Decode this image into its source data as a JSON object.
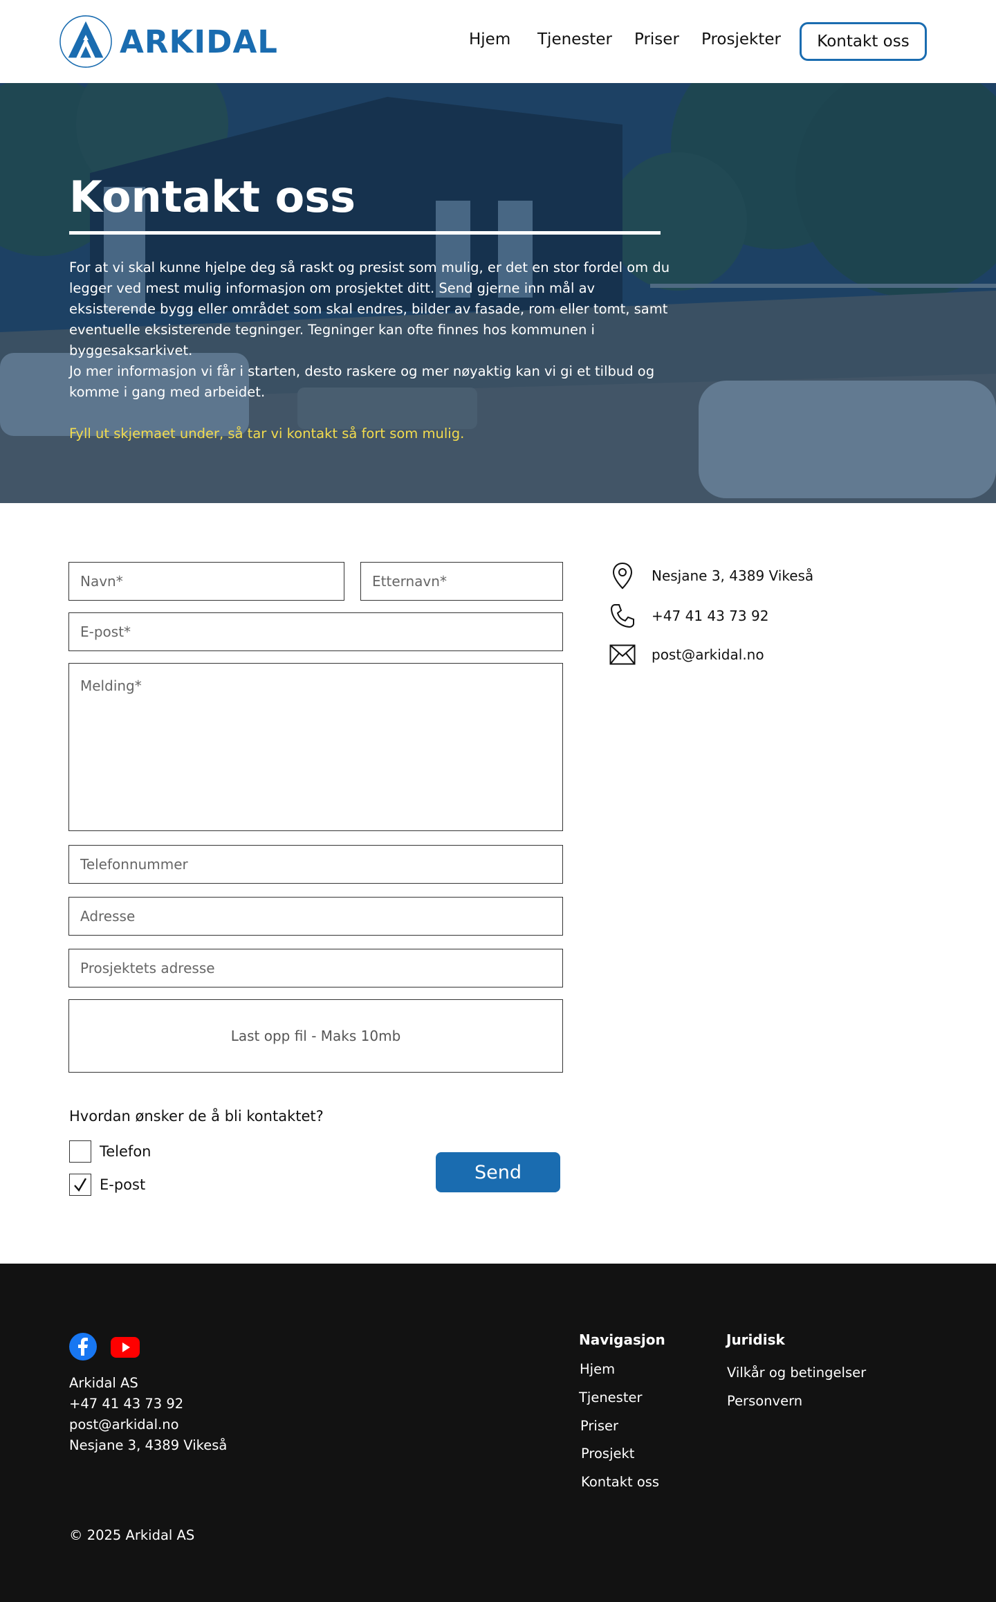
{
  "header": {
    "brand": "ARKIDAL",
    "nav": [
      "Hjem",
      "Tjenester",
      "Priser",
      "Prosjekter"
    ],
    "cta_label": "Kontakt oss"
  },
  "hero": {
    "title": "Kontakt oss",
    "paragraph1": "For at vi skal kunne hjelpe deg så raskt og presist som mulig, er det en stor fordel om du legger ved mest mulig informasjon om prosjektet ditt. Send gjerne inn mål av eksisterende bygg eller området som skal endres, bilder av fasade, rom eller tomt, samt eventuelle eksisterende tegninger. Tegninger kan ofte finnes hos kommunen i byggesaksarkivet.",
    "paragraph2": "Jo mer informasjon vi får i starten, desto raskere og mer nøyaktig kan vi gi et tilbud og komme i gang med arbeidet.",
    "paragraph3": "Fyll ut skjemaet under, så tar vi kontakt så fort som mulig."
  },
  "form": {
    "first_name_placeholder": "Navn*",
    "last_name_placeholder": "Etternavn*",
    "email_placeholder": "E-post*",
    "message_placeholder": "Melding*",
    "phone_placeholder": "Telefonnummer",
    "address_placeholder": "Adresse",
    "project_address_placeholder": "Prosjektets adresse",
    "upload_label": "Last opp fil - Maks 10mb",
    "contact_question": "Hvordan ønsker de å bli kontaktet?",
    "options": [
      {
        "label": "Telefon",
        "checked": false
      },
      {
        "label": "E-post",
        "checked": true
      }
    ],
    "submit_label": "Send"
  },
  "contact_info": {
    "address": "Nesjane 3, 4389 Vikeså",
    "phone": "+47 41 43 73 92",
    "email": "post@arkidal.no"
  },
  "footer": {
    "company": "Arkidal AS",
    "phone": "+47 41 43 73 92",
    "email": "post@arkidal.no",
    "address": "Nesjane 3, 4389 Vikeså",
    "nav_title": "Navigasjon",
    "nav_links": [
      "Hjem",
      "Tjenester",
      "Priser",
      "Prosjekt",
      "Kontakt oss"
    ],
    "legal_title": "Juridisk",
    "legal_links": [
      "Vilkår og betingelser",
      "Personvern"
    ],
    "copyright": "© 2025 Arkidal AS"
  },
  "colors": {
    "brand_blue": "#1a6cb0",
    "hero_overlay": "#12375c",
    "highlight_yellow": "#f3dc4e",
    "footer_bg": "#121212",
    "facebook": "#1877f2",
    "youtube": "#ff0000"
  },
  "icons": [
    "location-pin-icon",
    "phone-icon",
    "mail-icon",
    "facebook-icon",
    "youtube-icon",
    "checkmark-icon"
  ]
}
